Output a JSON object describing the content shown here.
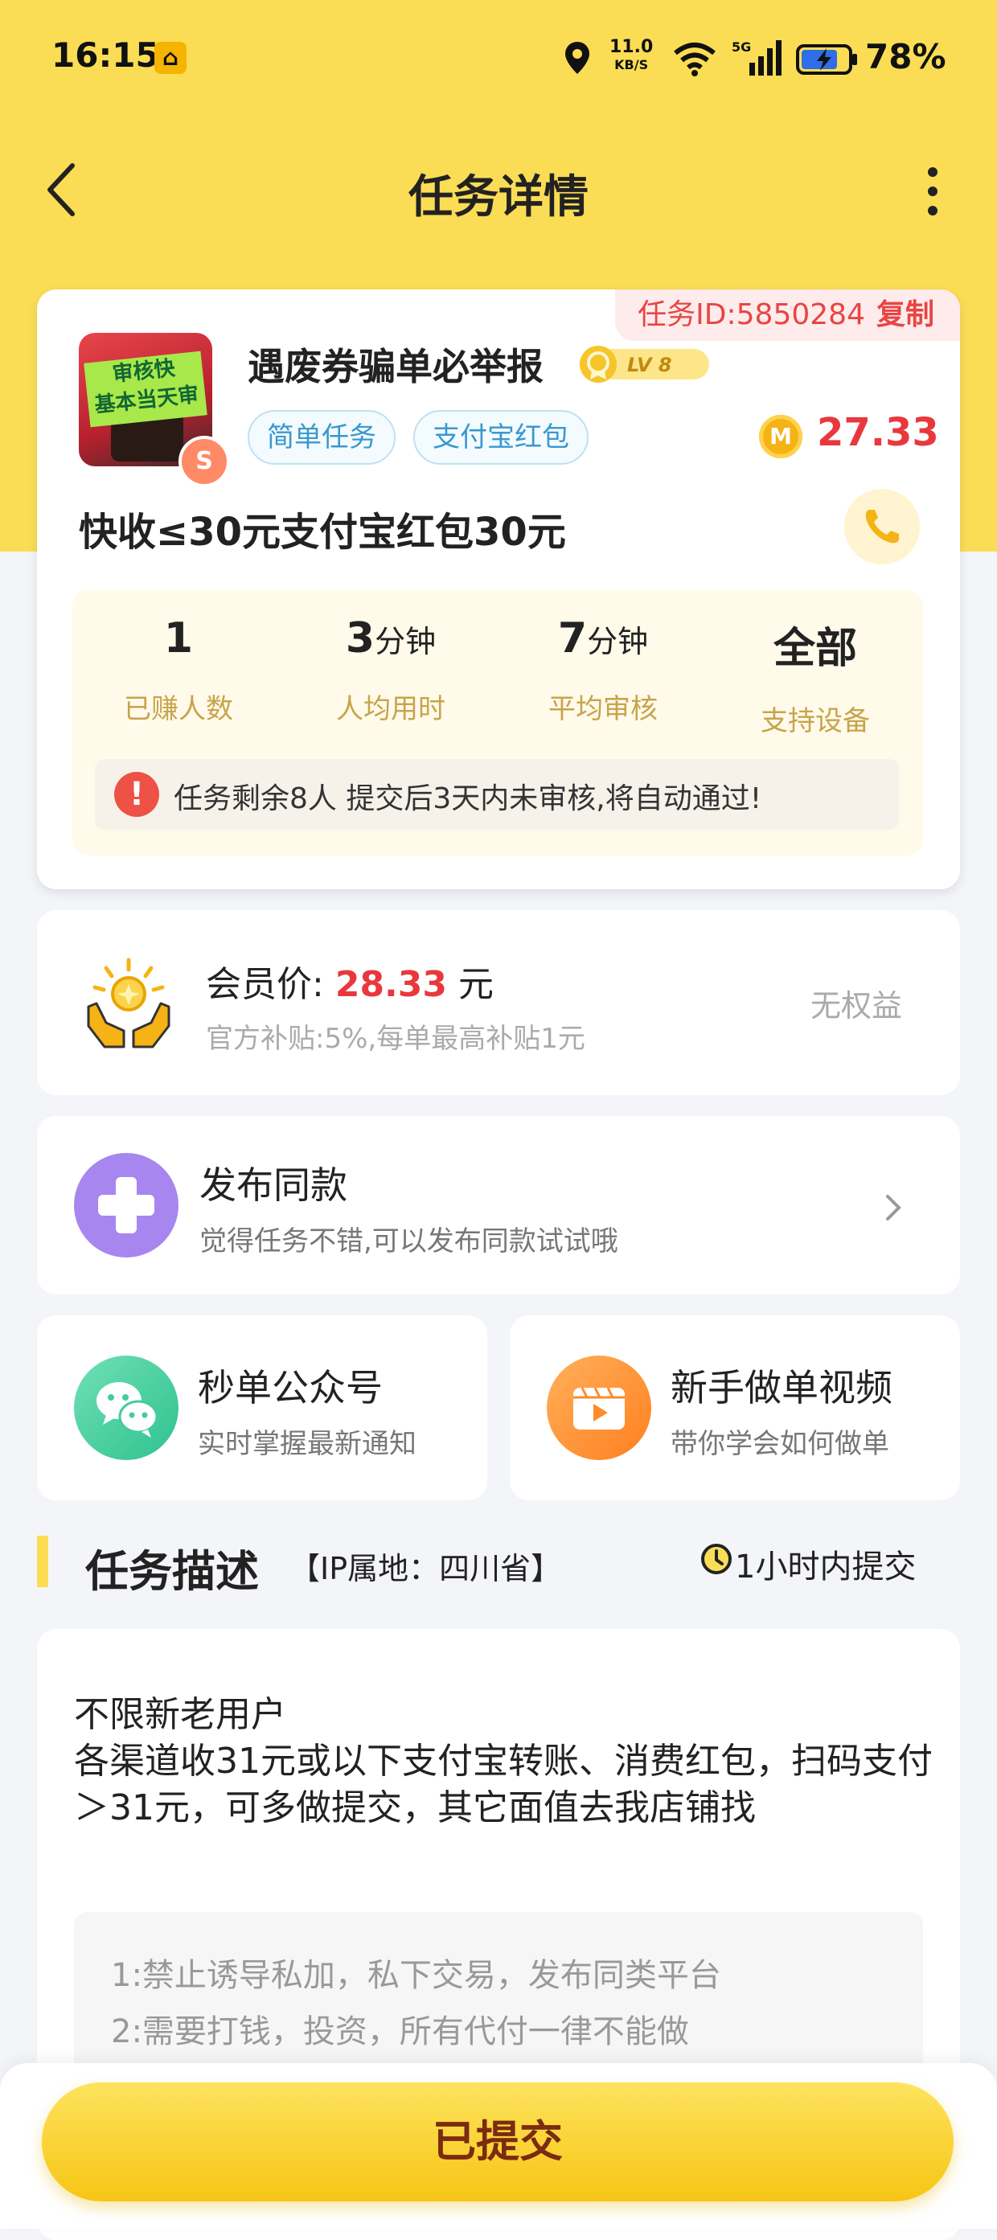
{
  "status_bar": {
    "time": "16:15",
    "net_speed": "11.0",
    "net_speed_unit": "KB/S",
    "signal_type": "5G",
    "battery_pct": "78%"
  },
  "nav": {
    "title": "任务详情",
    "back_icon": "back-arrow-icon",
    "more_icon": "more-vertical-icon"
  },
  "task": {
    "id_label": "任务ID:5850284",
    "copy_label": "复制",
    "thumbnail_text": [
      "审核快",
      "基本当天审"
    ],
    "thumbnail_badge": "S",
    "name": "遇废券骗单必举报",
    "level": "LV 8",
    "tags": [
      "简单任务",
      "支付宝红包"
    ],
    "coin_symbol": "M",
    "reward": "27.33",
    "subtitle": "快收≤30元支付宝红包30元",
    "stats": [
      {
        "value": "1",
        "unit": "",
        "label": "已赚人数"
      },
      {
        "value": "3",
        "unit": "分钟",
        "label": "人均用时"
      },
      {
        "value": "7",
        "unit": "分钟",
        "label": "平均审核"
      },
      {
        "value": "全部",
        "unit": "",
        "label": "支持设备"
      }
    ],
    "notice_icon": "!",
    "notice": "任务剩余8人  提交后3天内未审核,将自动通过!"
  },
  "member": {
    "price_prefix": "会员价:",
    "price": "28.33",
    "price_unit": "元",
    "subsidy": "官方补贴:5%,每单最高补贴1元",
    "right_label": "无权益"
  },
  "publish": {
    "title": "发布同款",
    "subtitle": "觉得任务不错,可以发布同款试试哦"
  },
  "wechat": {
    "title": "秒单公众号",
    "subtitle": "实时掌握最新通知"
  },
  "video": {
    "title": "新手做单视频",
    "subtitle": "带你学会如何做单"
  },
  "description": {
    "section_title": "任务描述",
    "ip_location": "【IP属地：四川省】",
    "deadline": "1小时内提交",
    "text": "不限新老用户\n各渠道收31元或以下支付宝转账、消费红包，扫码支付＞31元，可多做提交，其它面值去我店铺找",
    "rules": [
      "1:禁止诱导私加，私下交易，发布同类平台",
      "2:需要打钱，投资，所有代付一律不能做"
    ]
  },
  "bottom": {
    "submit_label": "已提交"
  },
  "colors": {
    "header_yellow": "#fbdd55",
    "price_red": "#e8383d",
    "tag_blue": "#3a98cf",
    "stat_label_gold": "#c7a44b"
  }
}
